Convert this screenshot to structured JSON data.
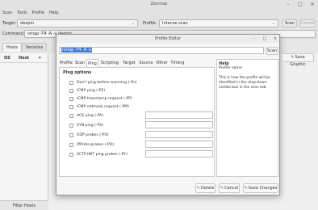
{
  "main": {
    "title": "Zenmap",
    "window_controls": [
      "–",
      "□",
      "✕"
    ],
    "menu": [
      "Scan",
      "Tools",
      "Profile",
      "Help"
    ],
    "target_label": "Target:",
    "target_value": "deepin",
    "profile_label": "Profile:",
    "profile_value": "Intense scan",
    "scan_button": "Scan",
    "cancel_button": "Cancel",
    "command_label": "Command:",
    "command_value": "nmap -T4 -A -v deepin",
    "hosts_tab": "Hosts",
    "services_tab": "Services",
    "os_col": "OS",
    "host_col": "Host",
    "host_sort_icon": "▾",
    "filter_hosts": "Filter Hosts"
  },
  "dialog": {
    "title": "Profile Editor",
    "window_controls": [
      "–",
      "□",
      "✕"
    ],
    "command_value": "nmap -T4 -A -v",
    "scan_button": "Scan",
    "save_graphic_button": "Save Graphic",
    "tabs": [
      "Profile",
      "Scan",
      "Ping",
      "Scripting",
      "Target",
      "Source",
      "Other",
      "Timing"
    ],
    "active_tab": "Ping",
    "section_title": "Ping options",
    "options": [
      {
        "label": "Don't ping before scanning (-Pn)",
        "has_input": false
      },
      {
        "label": "ICMP ping (-PE)",
        "has_input": false
      },
      {
        "label": "ICMP timestamp request (-PP)",
        "has_input": false
      },
      {
        "label": "ICMP netmask request (-PM)",
        "has_input": false
      },
      {
        "label": "ACK ping (-PA)",
        "has_input": true
      },
      {
        "label": "SYN ping (-PS)",
        "has_input": true
      },
      {
        "label": "UDP probes (-PU)",
        "has_input": true
      },
      {
        "label": "IPProto probes (-PO)",
        "has_input": true
      },
      {
        "label": "SCTP INIT ping probes (-PY)",
        "has_input": true
      }
    ],
    "help_title": "Help",
    "help_subtitle": "Profile name",
    "help_body": "This is how the profile will be identified in the drop-down combo box in the scan tab.",
    "delete_button": "Delete",
    "cancel_button": "Cancel",
    "save_changes_button": "Save Changes"
  },
  "colors": {
    "selection": "#3d7bd1"
  }
}
